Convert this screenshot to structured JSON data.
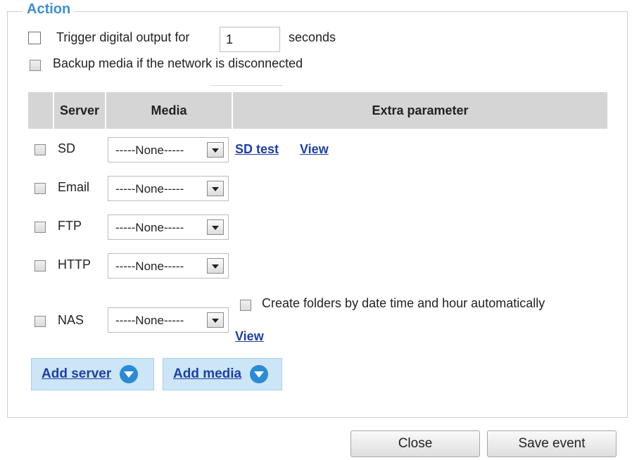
{
  "action": {
    "legend": "Action",
    "trigger": {
      "label": "Trigger digital output for",
      "value": "1",
      "unit": "seconds"
    },
    "backup": {
      "label": "Backup media if the network is disconnected"
    }
  },
  "table": {
    "headers": {
      "server": "Server",
      "media": "Media",
      "extra": "Extra parameter"
    },
    "rows": [
      {
        "server": "SD",
        "media": "-----None-----"
      },
      {
        "server": "Email",
        "media": "-----None-----"
      },
      {
        "server": "FTP",
        "media": "-----None-----"
      },
      {
        "server": "HTTP",
        "media": "-----None-----"
      },
      {
        "server": "NAS",
        "media": "-----None-----"
      }
    ],
    "sd_links": {
      "test": "SD test",
      "view": "View"
    },
    "nas_extra": {
      "create_folders": "Create folders by date time and hour automatically",
      "view": "View"
    }
  },
  "buttons": {
    "add_server": "Add server",
    "add_media": "Add media",
    "close": "Close",
    "save_event": "Save event"
  }
}
